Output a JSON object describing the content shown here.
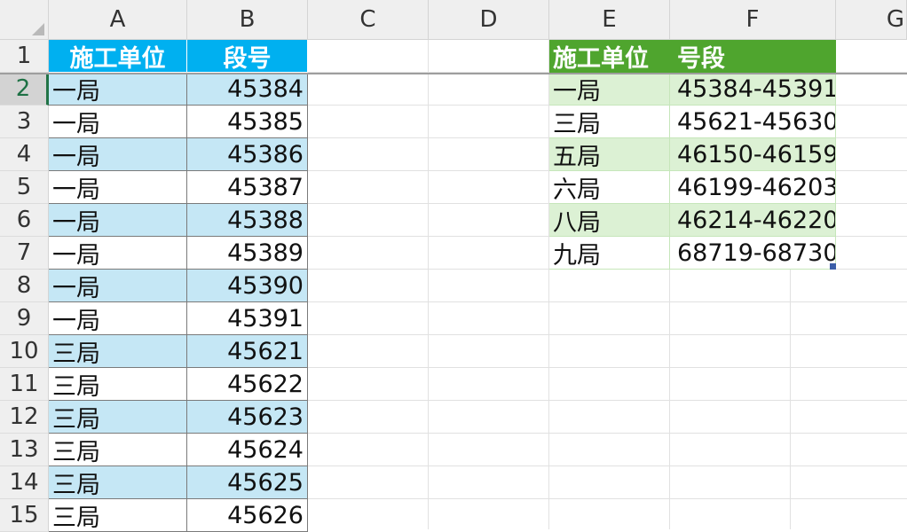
{
  "columns": [
    "A",
    "B",
    "C",
    "D",
    "E",
    "F",
    "G"
  ],
  "rows": [
    "1",
    "2",
    "3",
    "4",
    "5",
    "6",
    "7",
    "8",
    "9",
    "10",
    "11",
    "12",
    "13",
    "14",
    "15"
  ],
  "table_a": {
    "headers": [
      "施工单位",
      "段号"
    ],
    "rows": [
      [
        "一局",
        "45384"
      ],
      [
        "一局",
        "45385"
      ],
      [
        "一局",
        "45386"
      ],
      [
        "一局",
        "45387"
      ],
      [
        "一局",
        "45388"
      ],
      [
        "一局",
        "45389"
      ],
      [
        "一局",
        "45390"
      ],
      [
        "一局",
        "45391"
      ],
      [
        "三局",
        "45621"
      ],
      [
        "三局",
        "45622"
      ],
      [
        "三局",
        "45623"
      ],
      [
        "三局",
        "45624"
      ],
      [
        "三局",
        "45625"
      ],
      [
        "三局",
        "45626"
      ]
    ]
  },
  "table_b": {
    "headers": [
      "施工单位",
      "号段"
    ],
    "rows": [
      [
        "一局",
        "45384-45391"
      ],
      [
        "三局",
        "45621-45630"
      ],
      [
        "五局",
        "46150-46159"
      ],
      [
        "六局",
        "46199-46203"
      ],
      [
        "八局",
        "46214-46220"
      ],
      [
        "九局",
        "68719-68730"
      ]
    ]
  },
  "active_row": "2",
  "colors": {
    "table_a_header": "#00b0f0",
    "table_a_band": "#c5e7f5",
    "table_b_header": "#4fa52e",
    "table_b_band": "#dcf1d4",
    "selection_accent": "#217346"
  }
}
